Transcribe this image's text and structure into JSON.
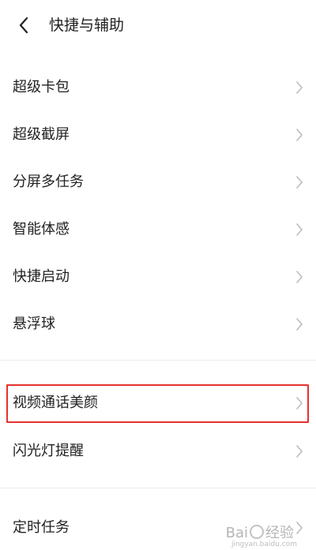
{
  "header": {
    "title": "快捷与辅助"
  },
  "items": [
    {
      "label": "超级卡包"
    },
    {
      "label": "超级截屏"
    },
    {
      "label": "分屏多任务"
    },
    {
      "label": "智能体感"
    },
    {
      "label": "快捷启动"
    },
    {
      "label": "悬浮球"
    },
    {
      "label": "视频通话美颜",
      "highlighted": true
    },
    {
      "label": "闪光灯提醒"
    },
    {
      "label": "定时任务"
    }
  ],
  "watermark": {
    "text_left": "Bai",
    "text_right": "经验",
    "sub": "jingyan.baidu.com"
  },
  "colors": {
    "highlight_border": "#e5312f",
    "chevron": "#bdbdbd",
    "text": "#222222"
  }
}
